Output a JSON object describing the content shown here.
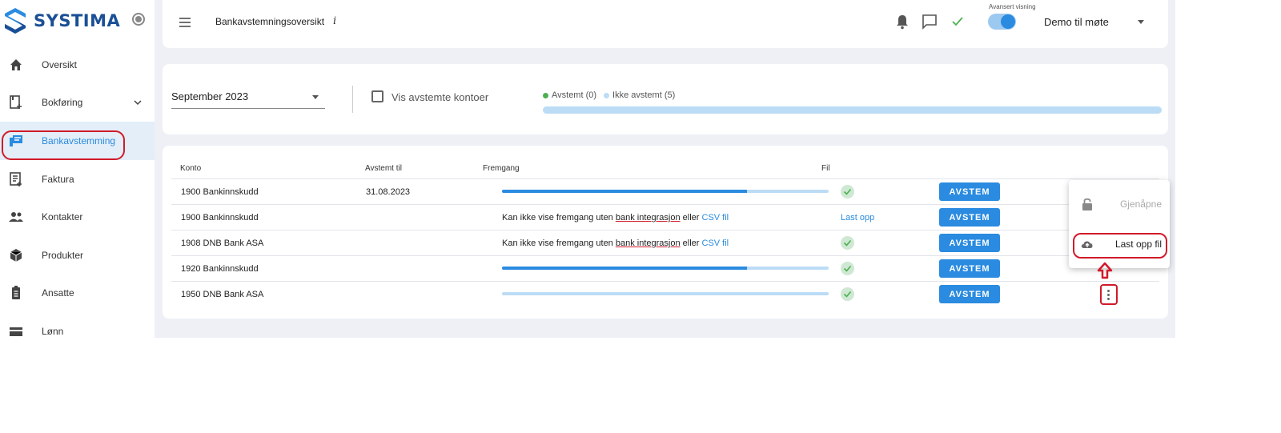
{
  "brand": {
    "name": "SYSTIMA"
  },
  "sidebar": {
    "items": [
      {
        "label": "Oversikt",
        "icon": "home-icon"
      },
      {
        "label": "Bokføring",
        "icon": "ledger-icon",
        "expandable": true
      },
      {
        "label": "Bankavstemming",
        "icon": "bank-reconcile-icon",
        "active": true
      },
      {
        "label": "Faktura",
        "icon": "invoice-icon"
      },
      {
        "label": "Kontakter",
        "icon": "contacts-icon"
      },
      {
        "label": "Produkter",
        "icon": "box-icon"
      },
      {
        "label": "Ansatte",
        "icon": "badge-icon"
      },
      {
        "label": "Lønn",
        "icon": "payroll-icon"
      }
    ]
  },
  "header": {
    "title": "Bankavstemningsoversikt",
    "info": "i",
    "toggle_label": "Avansert visning",
    "toggle_on": true,
    "company": "Demo til møte"
  },
  "filters": {
    "period": "September 2023",
    "show_reconciled_label": "Vis avstemte kontoer",
    "show_reconciled_checked": false,
    "legend": {
      "reconciled": "Avstemt (0)",
      "not_reconciled": "Ikke avstemt (5)"
    },
    "reconciled_fraction": 0
  },
  "table": {
    "headers": {
      "account": "Konto",
      "reconciled_to": "Avstemt til",
      "progress": "Fremgang",
      "file": "Fil"
    },
    "button_label": "AVSTEM",
    "message": {
      "prefix": "Kan ikke vise fremgang uten ",
      "bank_integration": "bank integrasjon",
      "or": " eller ",
      "csv": "CSV fil"
    },
    "upload_label": "Last opp",
    "rows": [
      {
        "account": "1900 Bankinnskudd",
        "reconciled_to": "31.08.2023",
        "progress": 0.75,
        "file": "ok"
      },
      {
        "account": "1900 Bankinnskudd",
        "reconciled_to": "",
        "progress": null,
        "file": "upload"
      },
      {
        "account": "1908 DNB Bank ASA",
        "reconciled_to": "",
        "progress": null,
        "file": "ok"
      },
      {
        "account": "1920 Bankinnskudd",
        "reconciled_to": "",
        "progress": 0.75,
        "file": "ok"
      },
      {
        "account": "1950 DNB Bank ASA",
        "reconciled_to": "",
        "progress": 0,
        "file": "ok"
      }
    ]
  },
  "row_menu": {
    "items": [
      {
        "label": "Gjenåpne",
        "icon": "lock-icon",
        "disabled": true
      },
      {
        "label": "Last opp fil",
        "icon": "cloud-upload-icon",
        "disabled": false
      }
    ]
  },
  "colors": {
    "accent": "#2a8be0",
    "highlight": "#d11a2a",
    "brand": "#1a4f96",
    "success": "#4caf50"
  }
}
